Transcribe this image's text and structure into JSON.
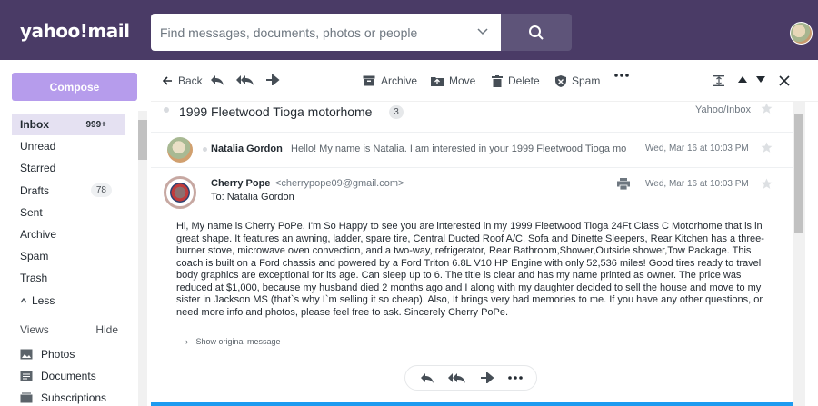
{
  "header": {
    "logo": "yahoo!mail",
    "search": {
      "placeholder": "Find messages, documents, photos or people"
    }
  },
  "sidebar": {
    "compose_label": "Compose",
    "items": [
      {
        "label": "Inbox",
        "count": "999+"
      },
      {
        "label": "Unread"
      },
      {
        "label": "Starred"
      },
      {
        "label": "Drafts",
        "count": "78"
      },
      {
        "label": "Sent"
      },
      {
        "label": "Archive"
      },
      {
        "label": "Spam"
      },
      {
        "label": "Trash"
      },
      {
        "label": "Less"
      }
    ],
    "views_label": "Views",
    "hide_label": "Hide",
    "views": [
      {
        "label": "Photos",
        "icon": "photo-icon"
      },
      {
        "label": "Documents",
        "icon": "document-icon"
      },
      {
        "label": "Subscriptions",
        "icon": "subscriptions-icon"
      }
    ]
  },
  "toolbar": {
    "back_label": "Back",
    "archive_label": "Archive",
    "move_label": "Move",
    "delete_label": "Delete",
    "spam_label": "Spam"
  },
  "message": {
    "subject": "1999 Fleetwood Tioga motorhome",
    "thread_count": "3",
    "folder": "Yahoo/Inbox",
    "thread_preview": {
      "name": "Natalia Gordon",
      "snippet": "Hello! My name is Natalia. I am interested in your 1999 Fleetwood Tioga mo",
      "date": "Wed, Mar 16 at 10:03 PM"
    },
    "from_name": "Cherry Pope",
    "from_email": "<cherrypope09@gmail.com>",
    "to": "To: Natalia Gordon",
    "date": "Wed, Mar 16 at 10:03 PM",
    "body": "Hi, My name is Cherry PoPe. I'm So Happy to see you are interested in my 1999 Fleetwood Tioga 24Ft Class C Motorhome that is in great shape. It features an awning, ladder, spare tire, Central Ducted Roof A/C, Sofa and Dinette Sleepers, Rear Kitchen has a three-burner stove, microwave oven convection, and a two-way, refrigerator, Rear Bathroom,Shower,Outside shower,Tow Package. This coach is built on a Ford chassis and powered by a Ford Triton 6.8L V10 HP Engine with only 52,536 miles! Good tires ready to travel body graphics are exceptional for its age. Can sleep up to 6. The title is clear and has my name printed as owner. The price was reduced at $1,000, because my husband died 2 months ago and I along with my daughter decided to sell the house and move to my sister in Jackson MS (that`s why I`m selling it so cheap). Also, It brings very bad memories to me. If you have any other questions, or need more info and photos, please feel free to ask. Sincerely Cherry PoPe.",
    "show_original_label": "Show original message"
  },
  "colors": {
    "header_bg": "#4a3b66",
    "compose_bg": "#b69cec",
    "active_nav_bg": "#e5e1f2",
    "accent_line": "#1d9bf0"
  }
}
